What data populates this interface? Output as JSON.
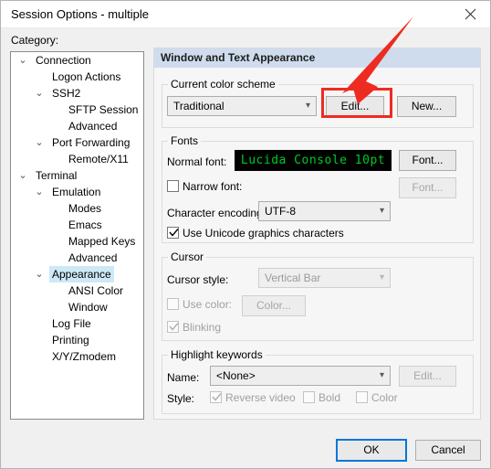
{
  "window": {
    "title": "Session Options - multiple",
    "close_icon": "close-icon"
  },
  "sidebar": {
    "label": "Category:",
    "items": [
      {
        "label": "Connection",
        "indent": 0,
        "twisty": "expanded",
        "selected": false
      },
      {
        "label": "Logon Actions",
        "indent": 1,
        "twisty": "none",
        "selected": false
      },
      {
        "label": "SSH2",
        "indent": 1,
        "twisty": "expanded",
        "selected": false
      },
      {
        "label": "SFTP Session",
        "indent": 2,
        "twisty": "none",
        "selected": false
      },
      {
        "label": "Advanced",
        "indent": 2,
        "twisty": "none",
        "selected": false
      },
      {
        "label": "Port Forwarding",
        "indent": 1,
        "twisty": "expanded",
        "selected": false
      },
      {
        "label": "Remote/X11",
        "indent": 2,
        "twisty": "none",
        "selected": false
      },
      {
        "label": "Terminal",
        "indent": 0,
        "twisty": "expanded",
        "selected": false
      },
      {
        "label": "Emulation",
        "indent": 1,
        "twisty": "expanded",
        "selected": false
      },
      {
        "label": "Modes",
        "indent": 2,
        "twisty": "none",
        "selected": false
      },
      {
        "label": "Emacs",
        "indent": 2,
        "twisty": "none",
        "selected": false
      },
      {
        "label": "Mapped Keys",
        "indent": 2,
        "twisty": "none",
        "selected": false
      },
      {
        "label": "Advanced",
        "indent": 2,
        "twisty": "none",
        "selected": false
      },
      {
        "label": "Appearance",
        "indent": 1,
        "twisty": "expanded",
        "selected": true
      },
      {
        "label": "ANSI Color",
        "indent": 2,
        "twisty": "none",
        "selected": false
      },
      {
        "label": "Window",
        "indent": 2,
        "twisty": "none",
        "selected": false
      },
      {
        "label": "Log File",
        "indent": 1,
        "twisty": "none",
        "selected": false
      },
      {
        "label": "Printing",
        "indent": 1,
        "twisty": "none",
        "selected": false
      },
      {
        "label": "X/Y/Zmodem",
        "indent": 1,
        "twisty": "none",
        "selected": false
      }
    ]
  },
  "panel": {
    "header": "Window and Text Appearance",
    "color_scheme": {
      "group_title": "Current color scheme",
      "selected": "Traditional",
      "edit_label": "Edit...",
      "new_label": "New..."
    },
    "fonts": {
      "group_title": "Fonts",
      "normal_font_label": "Normal font:",
      "normal_font_sample": "Lucida Console 10pt",
      "normal_font_button": "Font...",
      "narrow_font_label": "Narrow font:",
      "narrow_font_checked": false,
      "narrow_font_button": "Font...",
      "encoding_label": "Character encoding:",
      "encoding_value": "UTF-8",
      "unicode_graphics_label": "Use Unicode graphics characters",
      "unicode_graphics_checked": true
    },
    "cursor": {
      "group_title": "Cursor",
      "style_label": "Cursor style:",
      "style_value": "Vertical Bar",
      "use_color_label": "Use color:",
      "use_color_checked": false,
      "color_button": "Color...",
      "blinking_label": "Blinking",
      "blinking_checked": true
    },
    "highlight": {
      "group_title": "Highlight keywords",
      "name_label": "Name:",
      "name_value": "<None>",
      "edit_label": "Edit...",
      "style_label": "Style:",
      "reverse_video_label": "Reverse video",
      "reverse_video_checked": true,
      "bold_label": "Bold",
      "bold_checked": false,
      "color_label": "Color",
      "color_checked": false
    }
  },
  "footer": {
    "ok_label": "OK",
    "cancel_label": "Cancel"
  },
  "annotations": {
    "arrow_color": "#ee2b20",
    "highlight_color": "#ee2b20",
    "target": "edit-color-scheme-button"
  },
  "colors": {
    "panel_header_bg": "#cfdced",
    "selection_bg": "#cde8f7",
    "font_preview_bg": "#000000",
    "font_preview_fg": "#00cc22",
    "default_button_border": "#0078d7"
  }
}
